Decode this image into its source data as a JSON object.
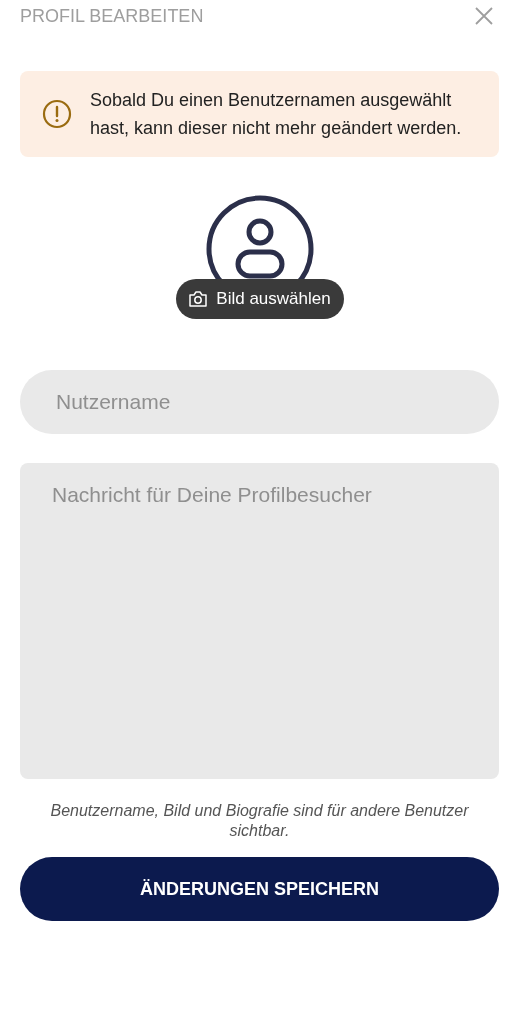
{
  "header": {
    "title": "PROFIL BEARBEITEN"
  },
  "notice": {
    "text": "Sobald Du einen Benutzernamen ausgewählt hast, kann dieser nicht mehr geändert werden."
  },
  "avatar": {
    "button": "Bild auswählen"
  },
  "username": {
    "placeholder": "Nutzername"
  },
  "bio": {
    "placeholder": "Nachricht für Deine Profilbesucher"
  },
  "caption": "Benutzername, Bild und Biografie sind für andere Benutzer sichtbar.",
  "save_button": "ÄNDERUNGEN SPEICHERN"
}
